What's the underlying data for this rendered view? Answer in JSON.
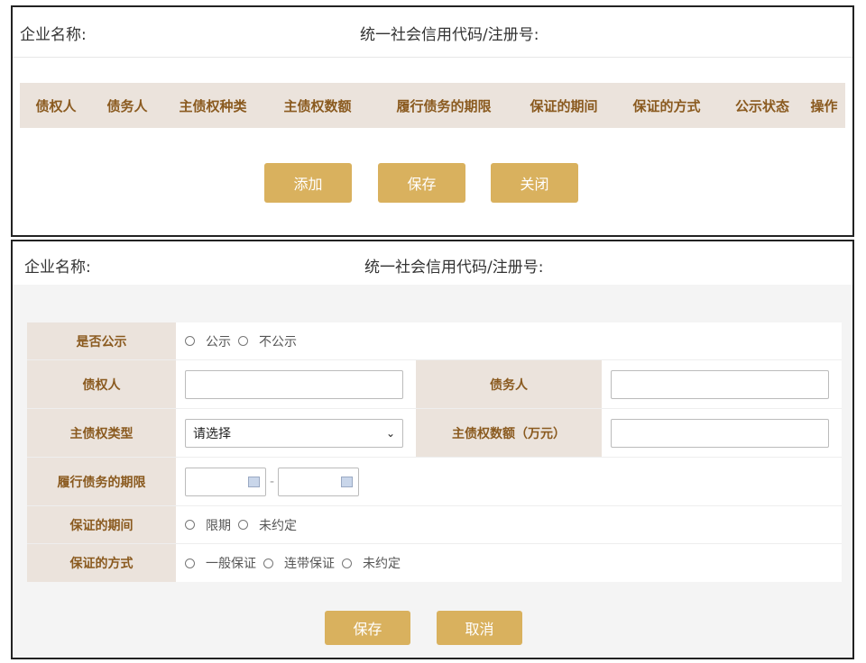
{
  "panel1": {
    "company_label": "企业名称:",
    "code_label": "统一社会信用代码/注册号:",
    "columns": [
      "债权人",
      "债务人",
      "主债权种类",
      "主债权数额",
      "履行债务的期限",
      "保证的期间",
      "保证的方式",
      "公示状态",
      "操作"
    ],
    "buttons": {
      "add": "添加",
      "save": "保存",
      "close": "关闭"
    }
  },
  "panel2": {
    "company_label": "企业名称:",
    "code_label": "统一社会信用代码/注册号:",
    "form": {
      "publicize": {
        "label": "是否公示",
        "options": [
          "公示",
          "不公示"
        ]
      },
      "creditor": {
        "label": "债权人",
        "value": ""
      },
      "debtor": {
        "label": "债务人",
        "value": ""
      },
      "claim_type": {
        "label": "主债权类型",
        "selected": "请选择"
      },
      "claim_amount": {
        "label": "主债权数额（万元）",
        "value": ""
      },
      "term": {
        "label": "履行债务的期限",
        "separator": "-"
      },
      "guarantee_period": {
        "label": "保证的期间",
        "options": [
          "限期",
          "未约定"
        ]
      },
      "guarantee_method": {
        "label": "保证的方式",
        "options": [
          "一般保证",
          "连带保证",
          "未约定"
        ]
      }
    },
    "buttons": {
      "save": "保存",
      "cancel": "取消"
    }
  },
  "colors": {
    "accent": "#d9b15e",
    "label_bg": "#ebe3dc",
    "label_text": "#8a5a1f"
  }
}
